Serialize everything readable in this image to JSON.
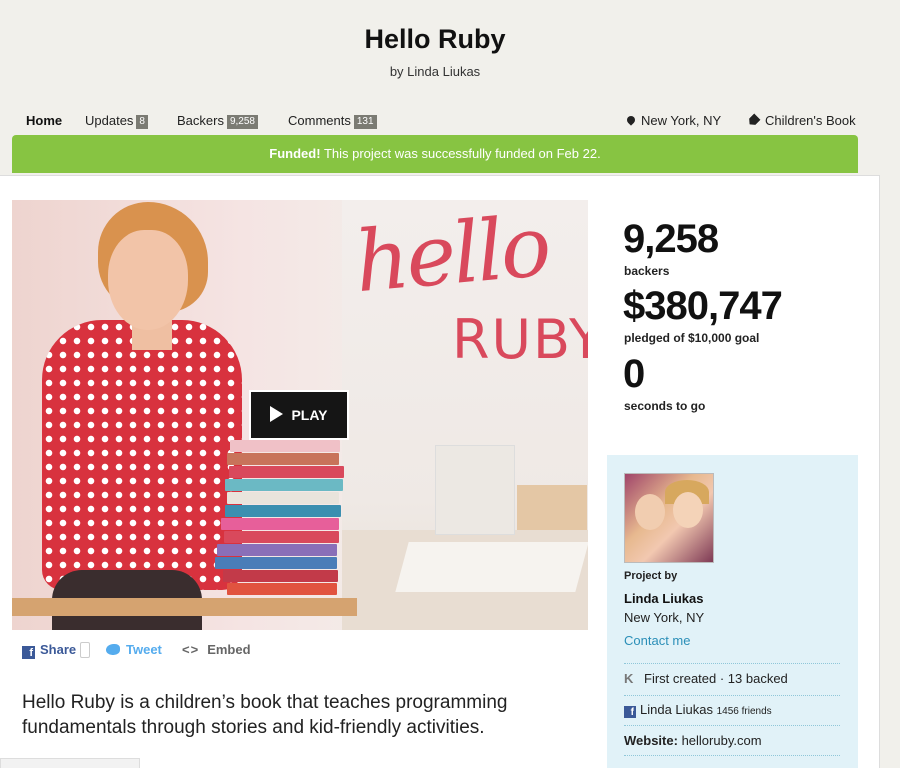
{
  "project": {
    "title": "Hello Ruby",
    "byline": "by Linda Liukas"
  },
  "nav": {
    "home": "Home",
    "updates": {
      "label": "Updates",
      "count": "8"
    },
    "backers": {
      "label": "Backers",
      "count": "9,258"
    },
    "comments": {
      "label": "Comments",
      "count": "131"
    },
    "location": "New York, NY",
    "category": "Children's Book"
  },
  "banner": {
    "strong": "Funded!",
    "text": " This project was successfully funded on Feb 22."
  },
  "video": {
    "play_label": "PLAY",
    "overlay_hello": "hello",
    "overlay_ruby": "RUBY"
  },
  "share": {
    "share_label": "Share",
    "tweet_label": "Tweet",
    "embed_label": "Embed"
  },
  "blurb": "Hello Ruby is a children’s book that teaches programming fundamentals through stories and kid-friendly activities.",
  "stats": {
    "backers_count": "9,258",
    "backers_label": "backers",
    "pledged_amount": "$380,747",
    "pledged_label": "pledged of $10,000 goal",
    "seconds_count": "0",
    "seconds_label": "seconds to go"
  },
  "creator": {
    "project_by_label": "Project by",
    "name": "Linda Liukas",
    "location": "New York, NY",
    "contact": "Contact me",
    "created_info": "First created · 13 backed",
    "facebook_name": "Linda Liukas",
    "facebook_friends": "1456 friends",
    "website_label": "Website:",
    "website": "helloruby.com"
  },
  "colors": {
    "funded_green": "#87c442",
    "accent_red": "#d9495c",
    "creator_bg": "#e1f2f8",
    "link_blue": "#2b8fb8"
  }
}
